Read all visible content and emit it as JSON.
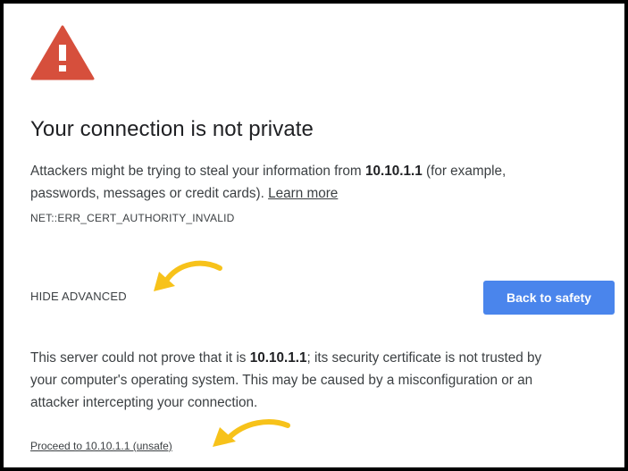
{
  "colors": {
    "warning_red": "#d64f3c",
    "button_blue": "#4a85ec",
    "annotation_yellow": "#f7c21a",
    "text": "#3c4043"
  },
  "icons": {
    "warning": "warning-triangle-icon",
    "annotation": "curved-arrow-icon"
  },
  "page": {
    "title": "Your connection is not private",
    "intro": {
      "text1": "Attackers might be trying to steal your information from ",
      "host": "10.10.1.1",
      "text2": " (for example,",
      "text3": "passwords, messages or credit cards). ",
      "learn_more": "Learn more"
    },
    "error_code": "NET::ERR_CERT_AUTHORITY_INVALID",
    "hide_advanced": "HIDE ADVANCED",
    "back_button": "Back to safety",
    "details": {
      "text1": "This server could not prove that it is ",
      "host": "10.10.1.1",
      "text2": "; its security certificate is not trusted by",
      "text3": "your computer's operating system. This may be caused by a misconfiguration or an",
      "text4": "attacker intercepting your connection."
    },
    "proceed_link": "Proceed to 10.10.1.1 (unsafe)"
  }
}
